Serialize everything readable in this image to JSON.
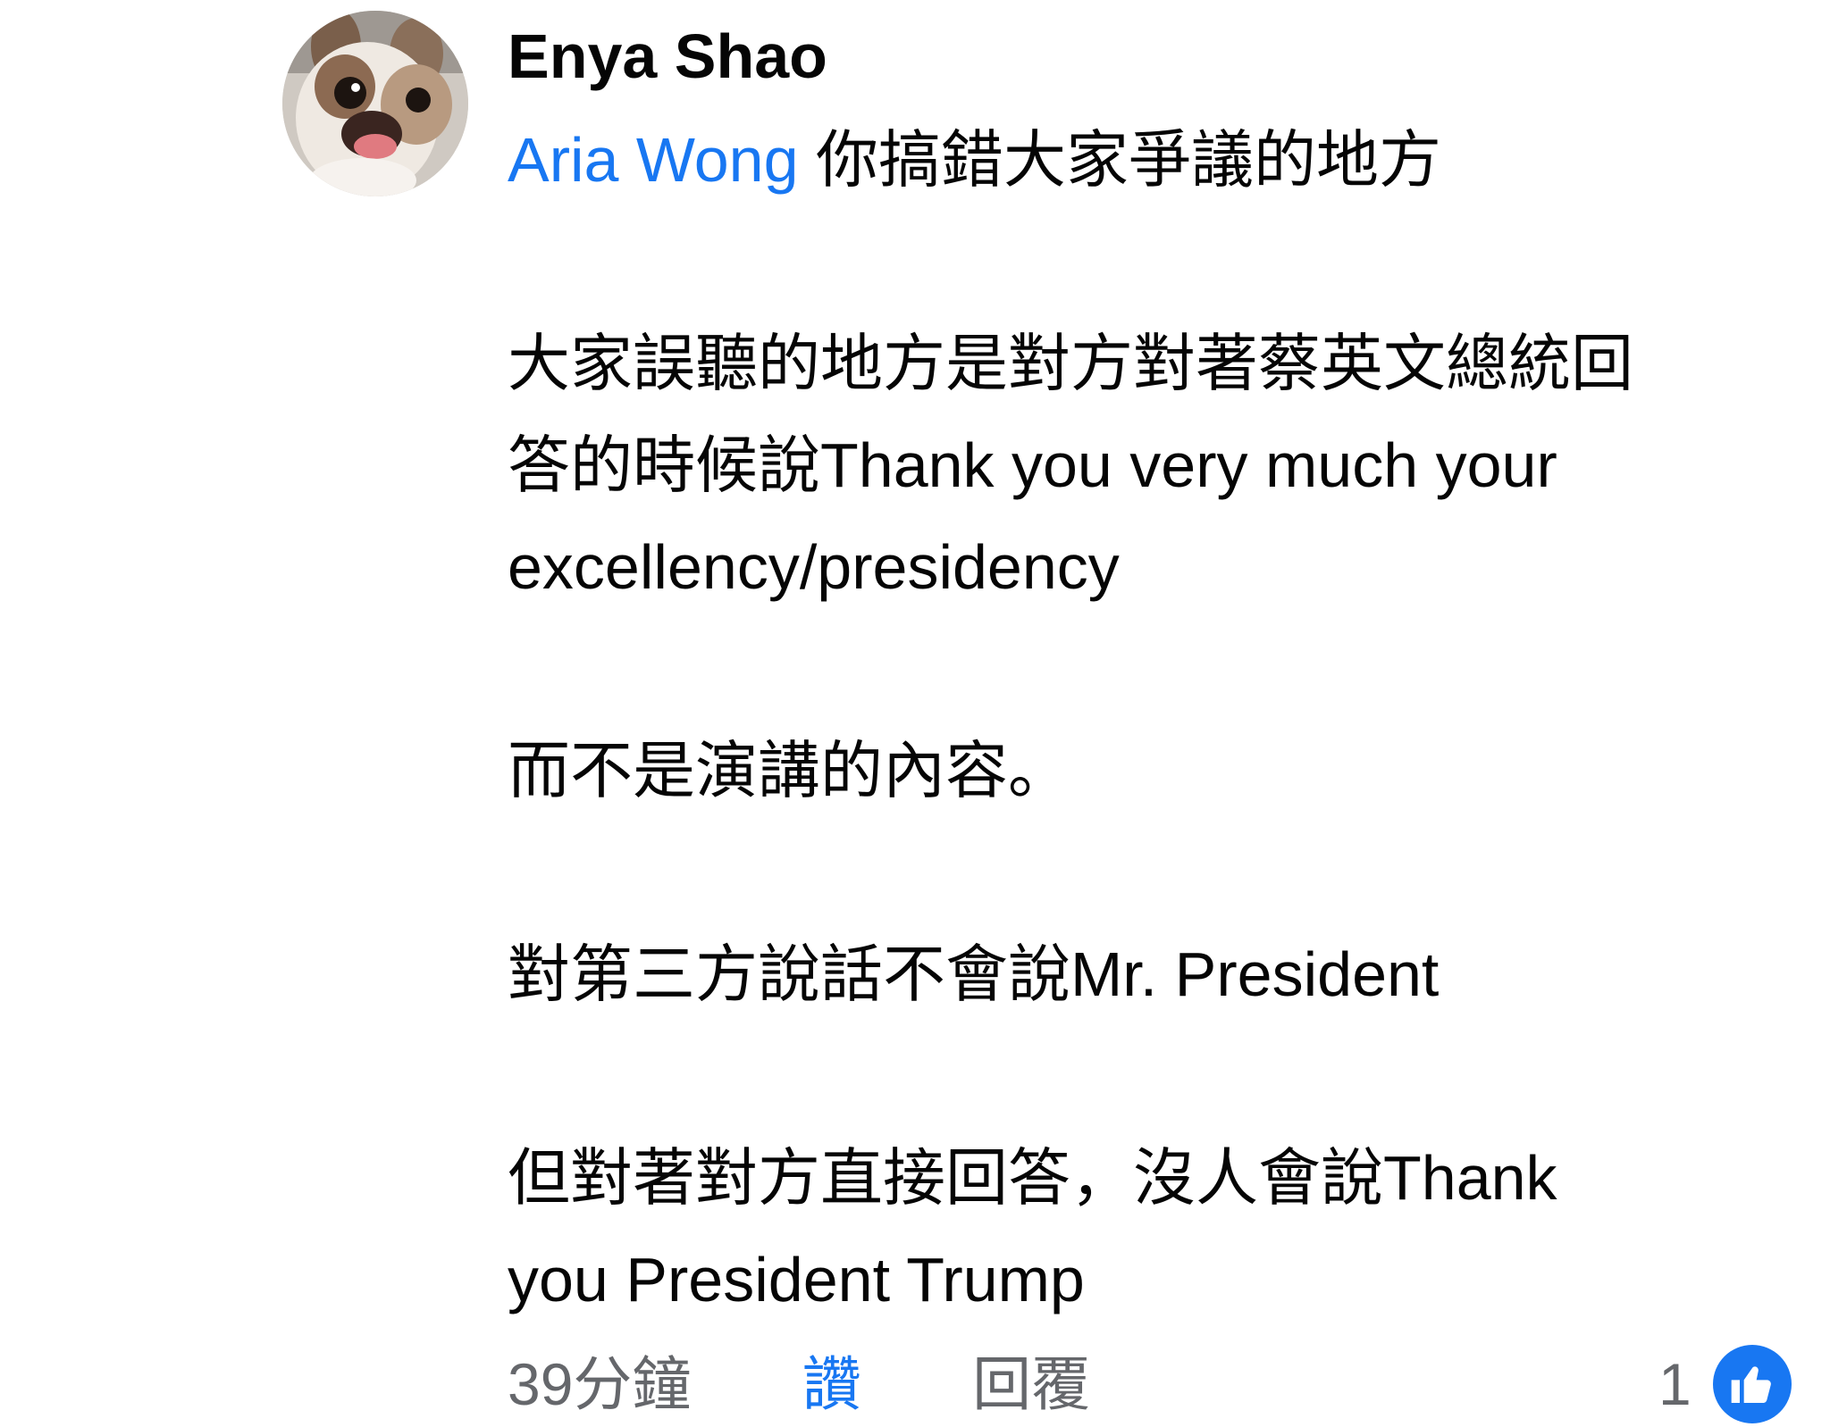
{
  "comment": {
    "author": "Enya Shao",
    "mention": "Aria Wong",
    "first_line_rest": " 你搞錯大家爭議的地方",
    "paragraph1": [
      "大家誤聽的地方是對方對著蔡英文總統回",
      "答的時候說Thank you very much your",
      "excellency/presidency"
    ],
    "paragraph2": "而不是演講的內容。",
    "paragraph3": "對第三方說話不會說Mr. President",
    "paragraph4": [
      "但對著對方直接回答，沒人會說Thank",
      "you President Trump"
    ]
  },
  "actions": {
    "time": "39分鐘",
    "like": "讚",
    "reply": "回覆"
  },
  "reactions": {
    "count": "1",
    "icon": "thumbs-up-icon",
    "color": "#1877f2"
  },
  "colors": {
    "text": "#050505",
    "secondary": "#65676b",
    "link": "#1877f2"
  }
}
